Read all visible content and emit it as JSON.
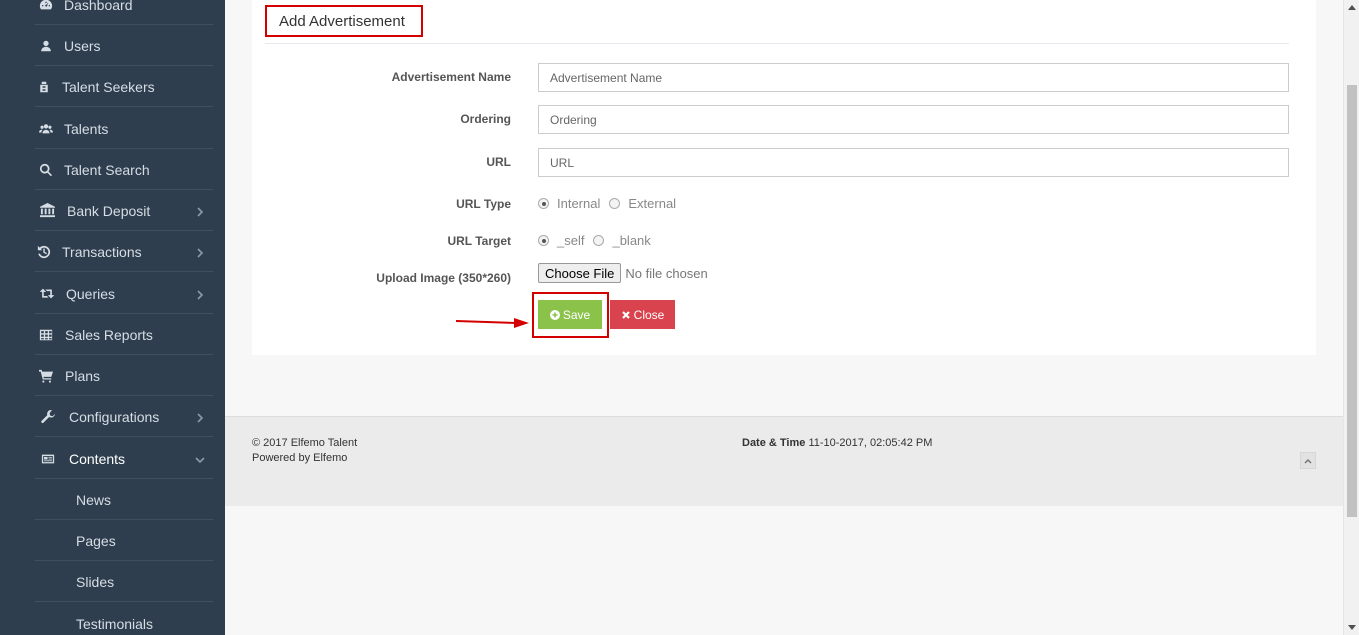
{
  "sidebar": {
    "items": [
      {
        "label": "Dashboard",
        "icon": "dashboard-icon"
      },
      {
        "label": "Users",
        "icon": "user-icon"
      },
      {
        "label": "Talent Seekers",
        "icon": "seeker-icon"
      },
      {
        "label": "Talents",
        "icon": "users-icon"
      },
      {
        "label": "Talent Search",
        "icon": "search-icon"
      },
      {
        "label": "Bank Deposit",
        "icon": "bank-icon"
      },
      {
        "label": "Transactions",
        "icon": "history-icon"
      },
      {
        "label": "Queries",
        "icon": "retweet-icon"
      },
      {
        "label": "Sales Reports",
        "icon": "table-icon"
      },
      {
        "label": "Plans",
        "icon": "cart-icon"
      },
      {
        "label": "Configurations",
        "icon": "wrench-icon"
      },
      {
        "label": "Contents",
        "icon": "newspaper-icon"
      }
    ],
    "subitems": [
      "News",
      "Pages",
      "Slides",
      "Testimonials"
    ]
  },
  "form": {
    "title": "Add Advertisement",
    "fields": {
      "name_label": "Advertisement Name",
      "name_placeholder": "Advertisement Name",
      "ordering_label": "Ordering",
      "ordering_placeholder": "Ordering",
      "url_label": "URL",
      "url_placeholder": "URL",
      "url_type_label": "URL Type",
      "url_type_options": [
        "Internal",
        "External"
      ],
      "url_type_selected": "Internal",
      "url_target_label": "URL Target",
      "url_target_options": [
        "_self",
        "_blank"
      ],
      "url_target_selected": "_self",
      "upload_label": "Upload Image (350*260)",
      "choose_file": "Choose File",
      "no_file": "No file chosen"
    },
    "buttons": {
      "save": "Save",
      "close": "Close"
    }
  },
  "footer": {
    "copyright": "© 2017 Elfemo Talent",
    "powered_prefix": "Powered by",
    "powered_by": "Elfemo",
    "datetime_label": "Date & Time",
    "datetime_value": "11-10-2017, 02:05:42 PM"
  },
  "colors": {
    "sidebar_bg": "#2e3e4e",
    "save_green": "#8bc34a",
    "close_red": "#d9434e",
    "highlight_red": "#d40000"
  }
}
